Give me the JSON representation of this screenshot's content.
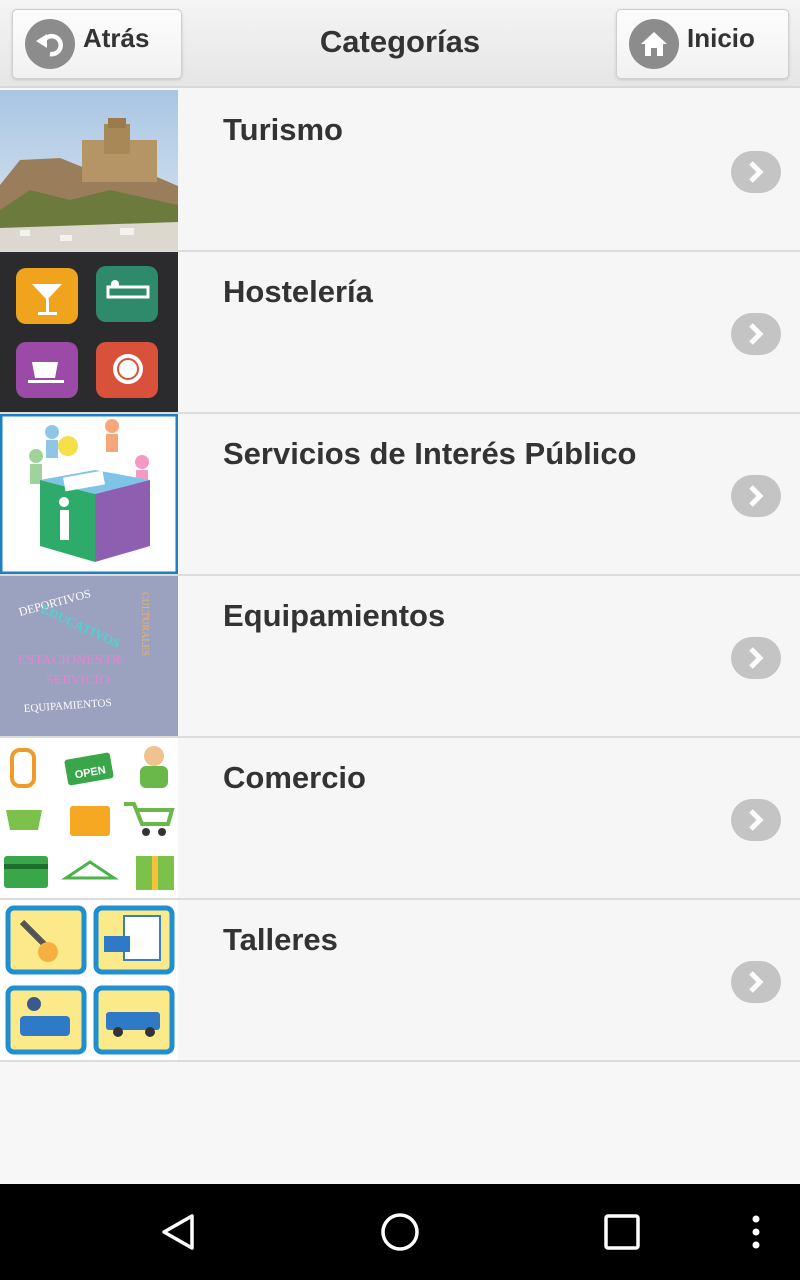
{
  "header": {
    "title": "Categorías",
    "back_label": "Atrás",
    "home_label": "Inicio"
  },
  "categories": [
    {
      "label": "Turismo",
      "thumb": "castle-photo"
    },
    {
      "label": "Hostelería",
      "thumb": "hospitality-icons"
    },
    {
      "label": "Servicios de Interés Público",
      "thumb": "info-cube"
    },
    {
      "label": "Equipamientos",
      "thumb": "equipment-wordcloud",
      "thumb_words": [
        "DEPORTIVOS",
        "EDUCATIVOS",
        "ESTACIONES DE",
        "SERVICIO",
        "EQUIPAMIENTOS",
        "CULTURALES"
      ]
    },
    {
      "label": "Comercio",
      "thumb": "shopping-icons",
      "thumb_text": "OPEN"
    },
    {
      "label": "Talleres",
      "thumb": "workshop-icons"
    }
  ],
  "colors": {
    "header_bg": "#ececec",
    "icon_gray": "#8c8c8c",
    "chevron_bg": "#c4c4c4",
    "text": "#333333",
    "navbar": "#000000"
  },
  "icons": {
    "back": "back-arrow-icon",
    "home": "home-icon",
    "chevron": "chevron-right-icon",
    "nav": [
      "back-triangle-icon",
      "home-circle-icon",
      "recents-square-icon",
      "overflow-menu-icon"
    ]
  }
}
